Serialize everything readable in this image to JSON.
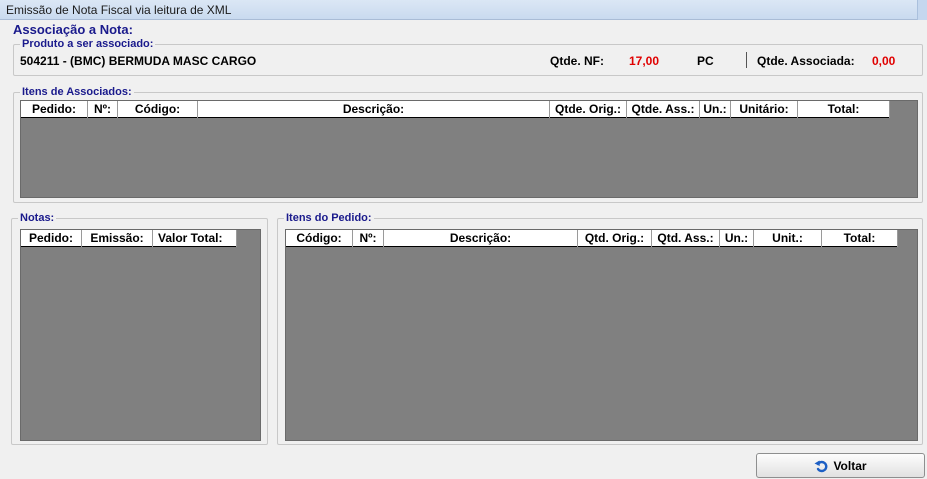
{
  "window": {
    "title": "Emissão de Nota Fiscal via leitura de XML"
  },
  "section": {
    "title": "Associação a Nota:"
  },
  "produto": {
    "legend": "Produto a ser associado:",
    "name": "504211 - (BMC) BERMUDA MASC CARGO",
    "qtde_nf_label": "Qtde. NF:",
    "qtde_nf_value": "17,00",
    "unit": "PC",
    "qtde_assoc_label": "Qtde. Associada:",
    "qtde_assoc_value": "0,00"
  },
  "itens_associados": {
    "legend": "Itens de Associados:",
    "columns": [
      "Pedido:",
      "Nº:",
      "Código:",
      "Descrição:",
      "Qtde. Orig.:",
      "Qtde. Ass.:",
      "Un.:",
      "Unitário:",
      "Total:"
    ]
  },
  "notas": {
    "legend": "Notas:",
    "columns": [
      "Pedido:",
      "Emissão:",
      "Valor Total:"
    ]
  },
  "itens_pedido": {
    "legend": "Itens do Pedido:",
    "columns": [
      "Código:",
      "Nº:",
      "Descrição:",
      "Qtd. Orig.:",
      "Qtd. Ass.:",
      "Un.:",
      "Unit.:",
      "Total:"
    ]
  },
  "footer": {
    "voltar_label": "Voltar",
    "voltar_icon": "undo-arrow-icon"
  },
  "colors": {
    "legend": "#1a1a8c",
    "red_value": "#e00000",
    "grid_bg": "#808080"
  }
}
